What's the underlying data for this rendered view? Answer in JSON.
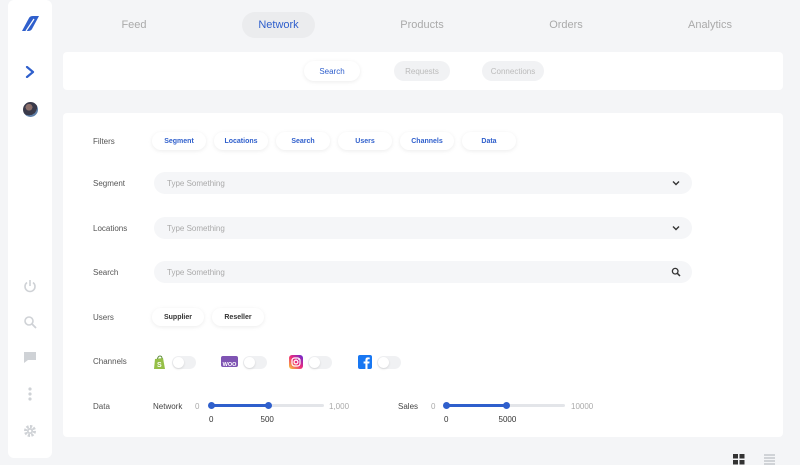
{
  "nav": {
    "tabs": [
      {
        "label": "Feed",
        "active": false
      },
      {
        "label": "Network",
        "active": true
      },
      {
        "label": "Products",
        "active": false
      },
      {
        "label": "Orders",
        "active": false
      },
      {
        "label": "Analytics",
        "active": false
      }
    ]
  },
  "subnav": {
    "tabs": [
      {
        "label": "Search",
        "active": true
      },
      {
        "label": "Requests",
        "active": false
      },
      {
        "label": "Connections",
        "active": false
      }
    ]
  },
  "filters": {
    "label": "Filters",
    "chips": [
      "Segment",
      "Locations",
      "Search",
      "Users",
      "Channels",
      "Data"
    ]
  },
  "segment": {
    "label": "Segment",
    "placeholder": "Type Something"
  },
  "locations": {
    "label": "Locations",
    "placeholder": "Type Something"
  },
  "search": {
    "label": "Search",
    "placeholder": "Type Something"
  },
  "users": {
    "label": "Users",
    "options": [
      "Supplier",
      "Reseller"
    ]
  },
  "channels": {
    "label": "Channels",
    "items": [
      {
        "icon": "shopify-icon",
        "color": "#95bf47",
        "enabled": false
      },
      {
        "icon": "woocommerce-icon",
        "color": "#7f54b3",
        "enabled": false
      },
      {
        "icon": "instagram-icon",
        "color": "#c13584",
        "enabled": false
      },
      {
        "icon": "facebook-icon",
        "color": "#1877f2",
        "enabled": false
      }
    ]
  },
  "data": {
    "label": "Data",
    "network": {
      "label": "Network",
      "min": "0",
      "max": "1,000",
      "low": 0,
      "high": 500,
      "low_label": "0",
      "high_label": "500"
    },
    "sales": {
      "label": "Sales",
      "min": "0",
      "max": "10000",
      "low": 0,
      "high": 5000,
      "low_label": "0",
      "high_label": "5000"
    }
  },
  "colors": {
    "accent": "#2f5fcc",
    "background": "#f4f5f7"
  }
}
